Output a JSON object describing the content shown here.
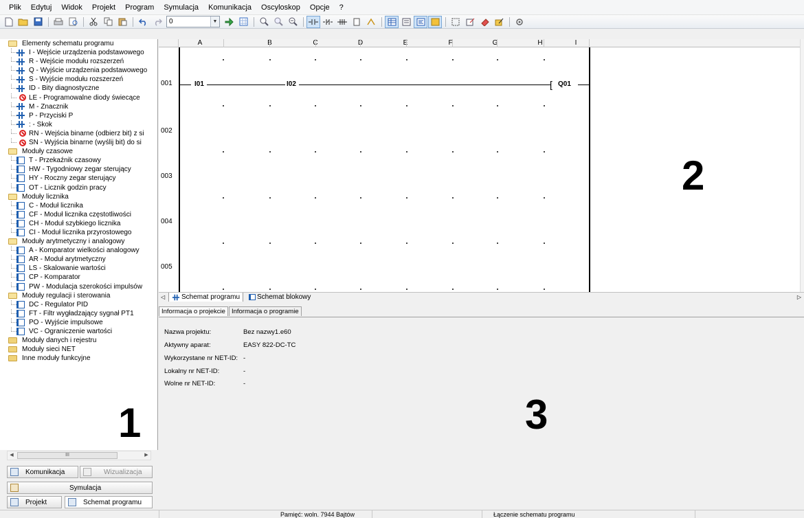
{
  "menu": [
    "Plik",
    "Edytuj",
    "Widok",
    "Projekt",
    "Program",
    "Symulacja",
    "Komunikacja",
    "Oscyloskop",
    "Opcje",
    "?"
  ],
  "toolbar": {
    "zoom_value": "0",
    "icons": [
      "new-file-icon",
      "open-folder-icon",
      "save-icon",
      "print-icon",
      "print-preview-icon",
      "cut-icon",
      "copy-icon",
      "paste-icon",
      "undo-icon",
      "redo-icon"
    ]
  },
  "tree": {
    "categories": [
      {
        "label": "Elementy schematu programu",
        "items": [
          {
            "label": "I - Wejście urządzenia podstawowego",
            "icon": "contact"
          },
          {
            "label": "R - Wejście modułu rozszerzeń",
            "icon": "contact"
          },
          {
            "label": "Q - Wyjście urządzenia podstawowego",
            "icon": "contact"
          },
          {
            "label": "S - Wyjście modułu rozszerzeń",
            "icon": "contact"
          },
          {
            "label": "ID - Bity diagnostyczne",
            "icon": "contact"
          },
          {
            "label": "LE - Programowalne diody świecące",
            "icon": "disabled"
          },
          {
            "label": "M - Znacznik",
            "icon": "contact"
          },
          {
            "label": "P - Przyciski P",
            "icon": "contact"
          },
          {
            "label": ": - Skok",
            "icon": "contact"
          },
          {
            "label": "RN - Wejścia binarne (odbierz bit) z si",
            "icon": "disabled"
          },
          {
            "label": "SN - Wyjścia binarne (wyślij bit) do si",
            "icon": "disabled"
          }
        ]
      },
      {
        "label": "Moduły czasowe",
        "items": [
          {
            "label": "T - Przekaźnik czasowy",
            "icon": "module"
          },
          {
            "label": "HW - Tygodniowy zegar sterujący",
            "icon": "module"
          },
          {
            "label": "HY - Roczny zegar sterujący",
            "icon": "module"
          },
          {
            "label": "OT - Licznik godzin pracy",
            "icon": "module"
          }
        ]
      },
      {
        "label": "Moduły licznika",
        "items": [
          {
            "label": "C - Moduł licznika",
            "icon": "module"
          },
          {
            "label": "CF - Moduł licznika częstotliwości",
            "icon": "module"
          },
          {
            "label": "CH - Moduł szybkiego licznika",
            "icon": "module"
          },
          {
            "label": "CI - Moduł licznika przyrostowego",
            "icon": "module"
          }
        ]
      },
      {
        "label": "Moduły arytmetyczny i analogowy",
        "items": [
          {
            "label": "A - Komparator wielkości analogowy",
            "icon": "module"
          },
          {
            "label": "AR - Moduł arytmetyczny",
            "icon": "module"
          },
          {
            "label": "LS - Skalowanie wartości",
            "icon": "module"
          },
          {
            "label": "CP - Komparator",
            "icon": "module"
          },
          {
            "label": "PW - Modulacja szerokości impulsów",
            "icon": "module"
          }
        ]
      },
      {
        "label": "Moduły regulacji i sterowania",
        "items": [
          {
            "label": "DC - Regulator PID",
            "icon": "module"
          },
          {
            "label": "FT - Filtr wygładzający sygnał PT1",
            "icon": "module"
          },
          {
            "label": "PO - Wyjście impulsowe",
            "icon": "module"
          },
          {
            "label": "VC - Ograniczenie wartości",
            "icon": "module"
          }
        ]
      },
      {
        "label": "Moduły danych i rejestru",
        "items": []
      },
      {
        "label": "Moduły sieci NET",
        "items": []
      },
      {
        "label": "Inne moduły funkcyjne",
        "items": []
      }
    ],
    "scroll_grip": "III"
  },
  "left_buttons": {
    "komunikacja": "Komunikacja",
    "wizualizacja": "Wizualizacja",
    "symulacja": "Symulacja",
    "projekt": "Projekt",
    "schemat_programu": "Schemat programu"
  },
  "diagram": {
    "columns": [
      "A",
      "B",
      "C",
      "D",
      "E",
      "F",
      "G",
      "H",
      "I"
    ],
    "rows": [
      "001",
      "002",
      "003",
      "004",
      "005"
    ],
    "contacts": [
      "I01",
      "I02"
    ],
    "coil": "Q01"
  },
  "tabs": {
    "schemat_programu": "Schemat programu",
    "schemat_blokowy": "Schemat blokowy"
  },
  "info": {
    "tabs": [
      "Informacja o projekcie",
      "Informacja o programie"
    ],
    "fields": [
      {
        "key": "Nazwa projektu:",
        "value": "Bez nazwy1.e60"
      },
      {
        "key": "Aktywny aparat:",
        "value": "EASY 822-DC-TC"
      },
      {
        "key": "Wykorzystane nr NET-ID:",
        "value": "-"
      },
      {
        "key": "Lokalny nr NET-ID:",
        "value": "-"
      },
      {
        "key": "Wolne nr NET-ID:",
        "value": "-"
      }
    ]
  },
  "overlay_labels": {
    "one": "1",
    "two": "2",
    "three": "3"
  },
  "status": {
    "memory": "Pamięć: woln. 7944 Bajtów",
    "message": "Łączenie schematu programu"
  }
}
